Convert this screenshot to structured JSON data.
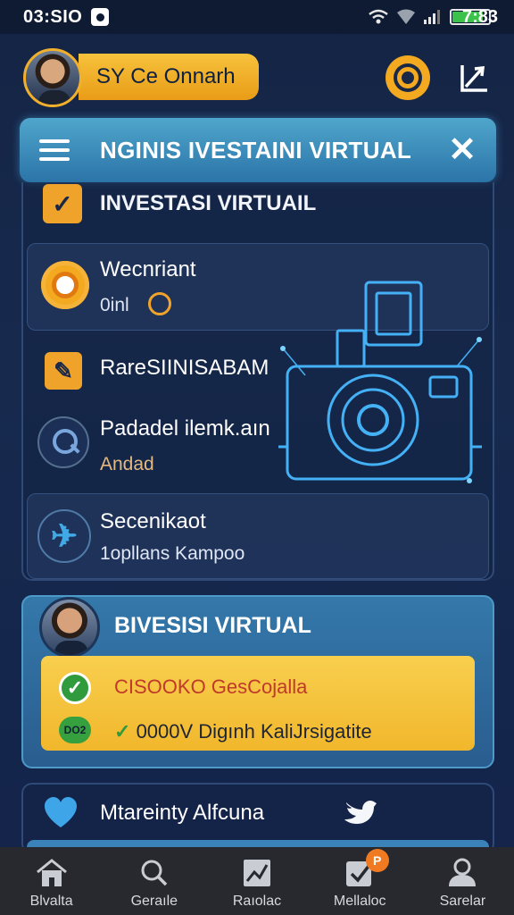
{
  "status_bar": {
    "time": "03:SIO",
    "battery_time": "7:83",
    "battery_level": 0.85,
    "icons": [
      "notification-icon",
      "wifi-icon",
      "signal-icon",
      "battery-icon"
    ]
  },
  "header": {
    "profile_name": "SY Ce Onnarh",
    "actions": [
      "gear-icon",
      "trend-icon"
    ]
  },
  "title_bar": {
    "title": "NGINIS IVESTAINI VIRTUAL",
    "menu_icon": "menu-icon",
    "close_icon": "close-icon",
    "close_glyph": "✕"
  },
  "invest_section": {
    "title": "INVESTASI VIRTUAIL",
    "rows": [
      {
        "icon": "sun-icon",
        "title": "Wecnriant",
        "sub": "0inl"
      },
      {
        "icon": "edit-icon",
        "title": "RareSIINISABAM"
      },
      {
        "icon": "search-icon",
        "title": "Padadel ilemk.aın",
        "sub": "Andad"
      },
      {
        "icon": "check-icon",
        "title": "Secenikaot",
        "sub": "1opllans Kampoo"
      }
    ]
  },
  "virtual_card": {
    "title": "BIVESISI VIRTUAL",
    "line1": "CISOOKO GesCojalla",
    "line2_prefix": "✓",
    "line2": "0000V Digınh KaliJrsigatite",
    "pill_label": "DO2"
  },
  "follow_card": {
    "title": "Mtareinty Alfcuna"
  },
  "bottom_nav": {
    "items": [
      {
        "label": "Blvalta",
        "icon": "home-icon"
      },
      {
        "label": "Geraıle",
        "icon": "search-icon"
      },
      {
        "label": "Raıolac",
        "icon": "chart-icon"
      },
      {
        "label": "Mellaloc",
        "icon": "checkbox-icon",
        "badge": "P"
      },
      {
        "label": "Sarelar",
        "icon": "profile-icon"
      }
    ]
  },
  "colors": {
    "background": "#142445",
    "accent_orange": "#f3a920",
    "accent_blue": "#3b82b8",
    "title_bar": "#4fa6cc",
    "highlight_yellow": "#f8cf4e",
    "success_green": "#2f9b3c",
    "nav_bg": "#27292e"
  }
}
